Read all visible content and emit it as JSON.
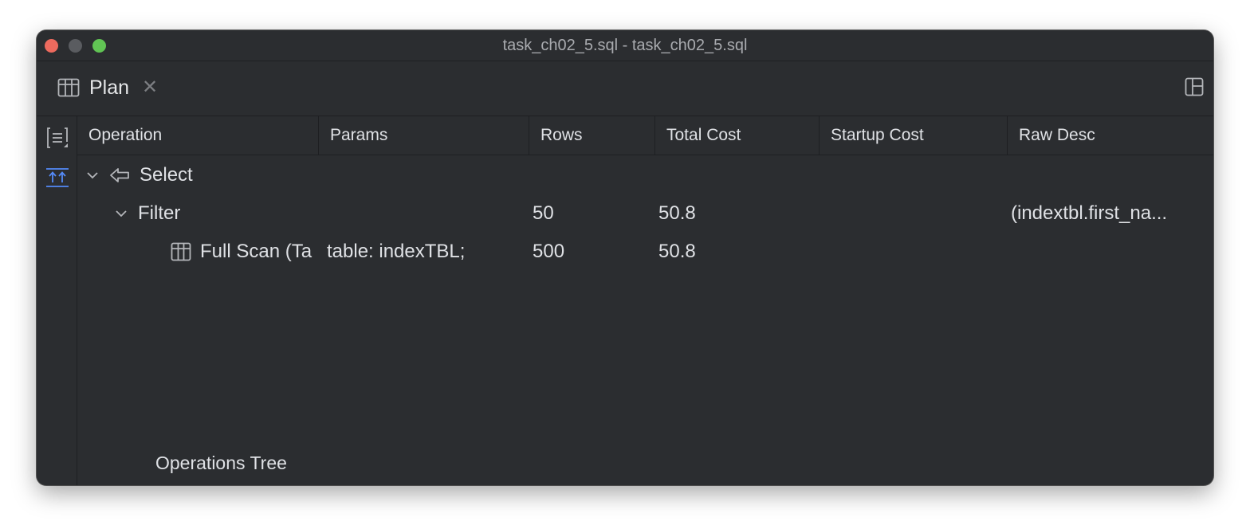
{
  "window": {
    "title": "task_ch02_5.sql - task_ch02_5.sql"
  },
  "tab": {
    "label": "Plan",
    "close_symbol": "✕"
  },
  "columns": [
    {
      "label": "Operation"
    },
    {
      "label": "Params"
    },
    {
      "label": "Rows"
    },
    {
      "label": "Total Cost"
    },
    {
      "label": "Startup Cost"
    },
    {
      "label": "Raw Desc"
    }
  ],
  "rows": [
    {
      "operation": "Select",
      "params": "",
      "rows": "",
      "total_cost": "",
      "startup_cost": "",
      "raw_desc": "",
      "icon": "arrow-left-icon",
      "expanded": true
    },
    {
      "operation": "Filter",
      "params": "",
      "rows": "50",
      "total_cost": "50.8",
      "startup_cost": "",
      "raw_desc": "(indextbl.first_na...",
      "icon": "none",
      "expanded": true
    },
    {
      "operation": "Full Scan (Ta",
      "params": "table: indexTBL;",
      "rows": "500",
      "total_cost": "50.8",
      "startup_cost": "",
      "raw_desc": "",
      "icon": "table-icon"
    }
  ],
  "footer": {
    "label": "Operations Tree"
  },
  "colors": {
    "background": "#2b2d30",
    "text": "#dfe1e5",
    "accent_icon": "#548af7"
  }
}
